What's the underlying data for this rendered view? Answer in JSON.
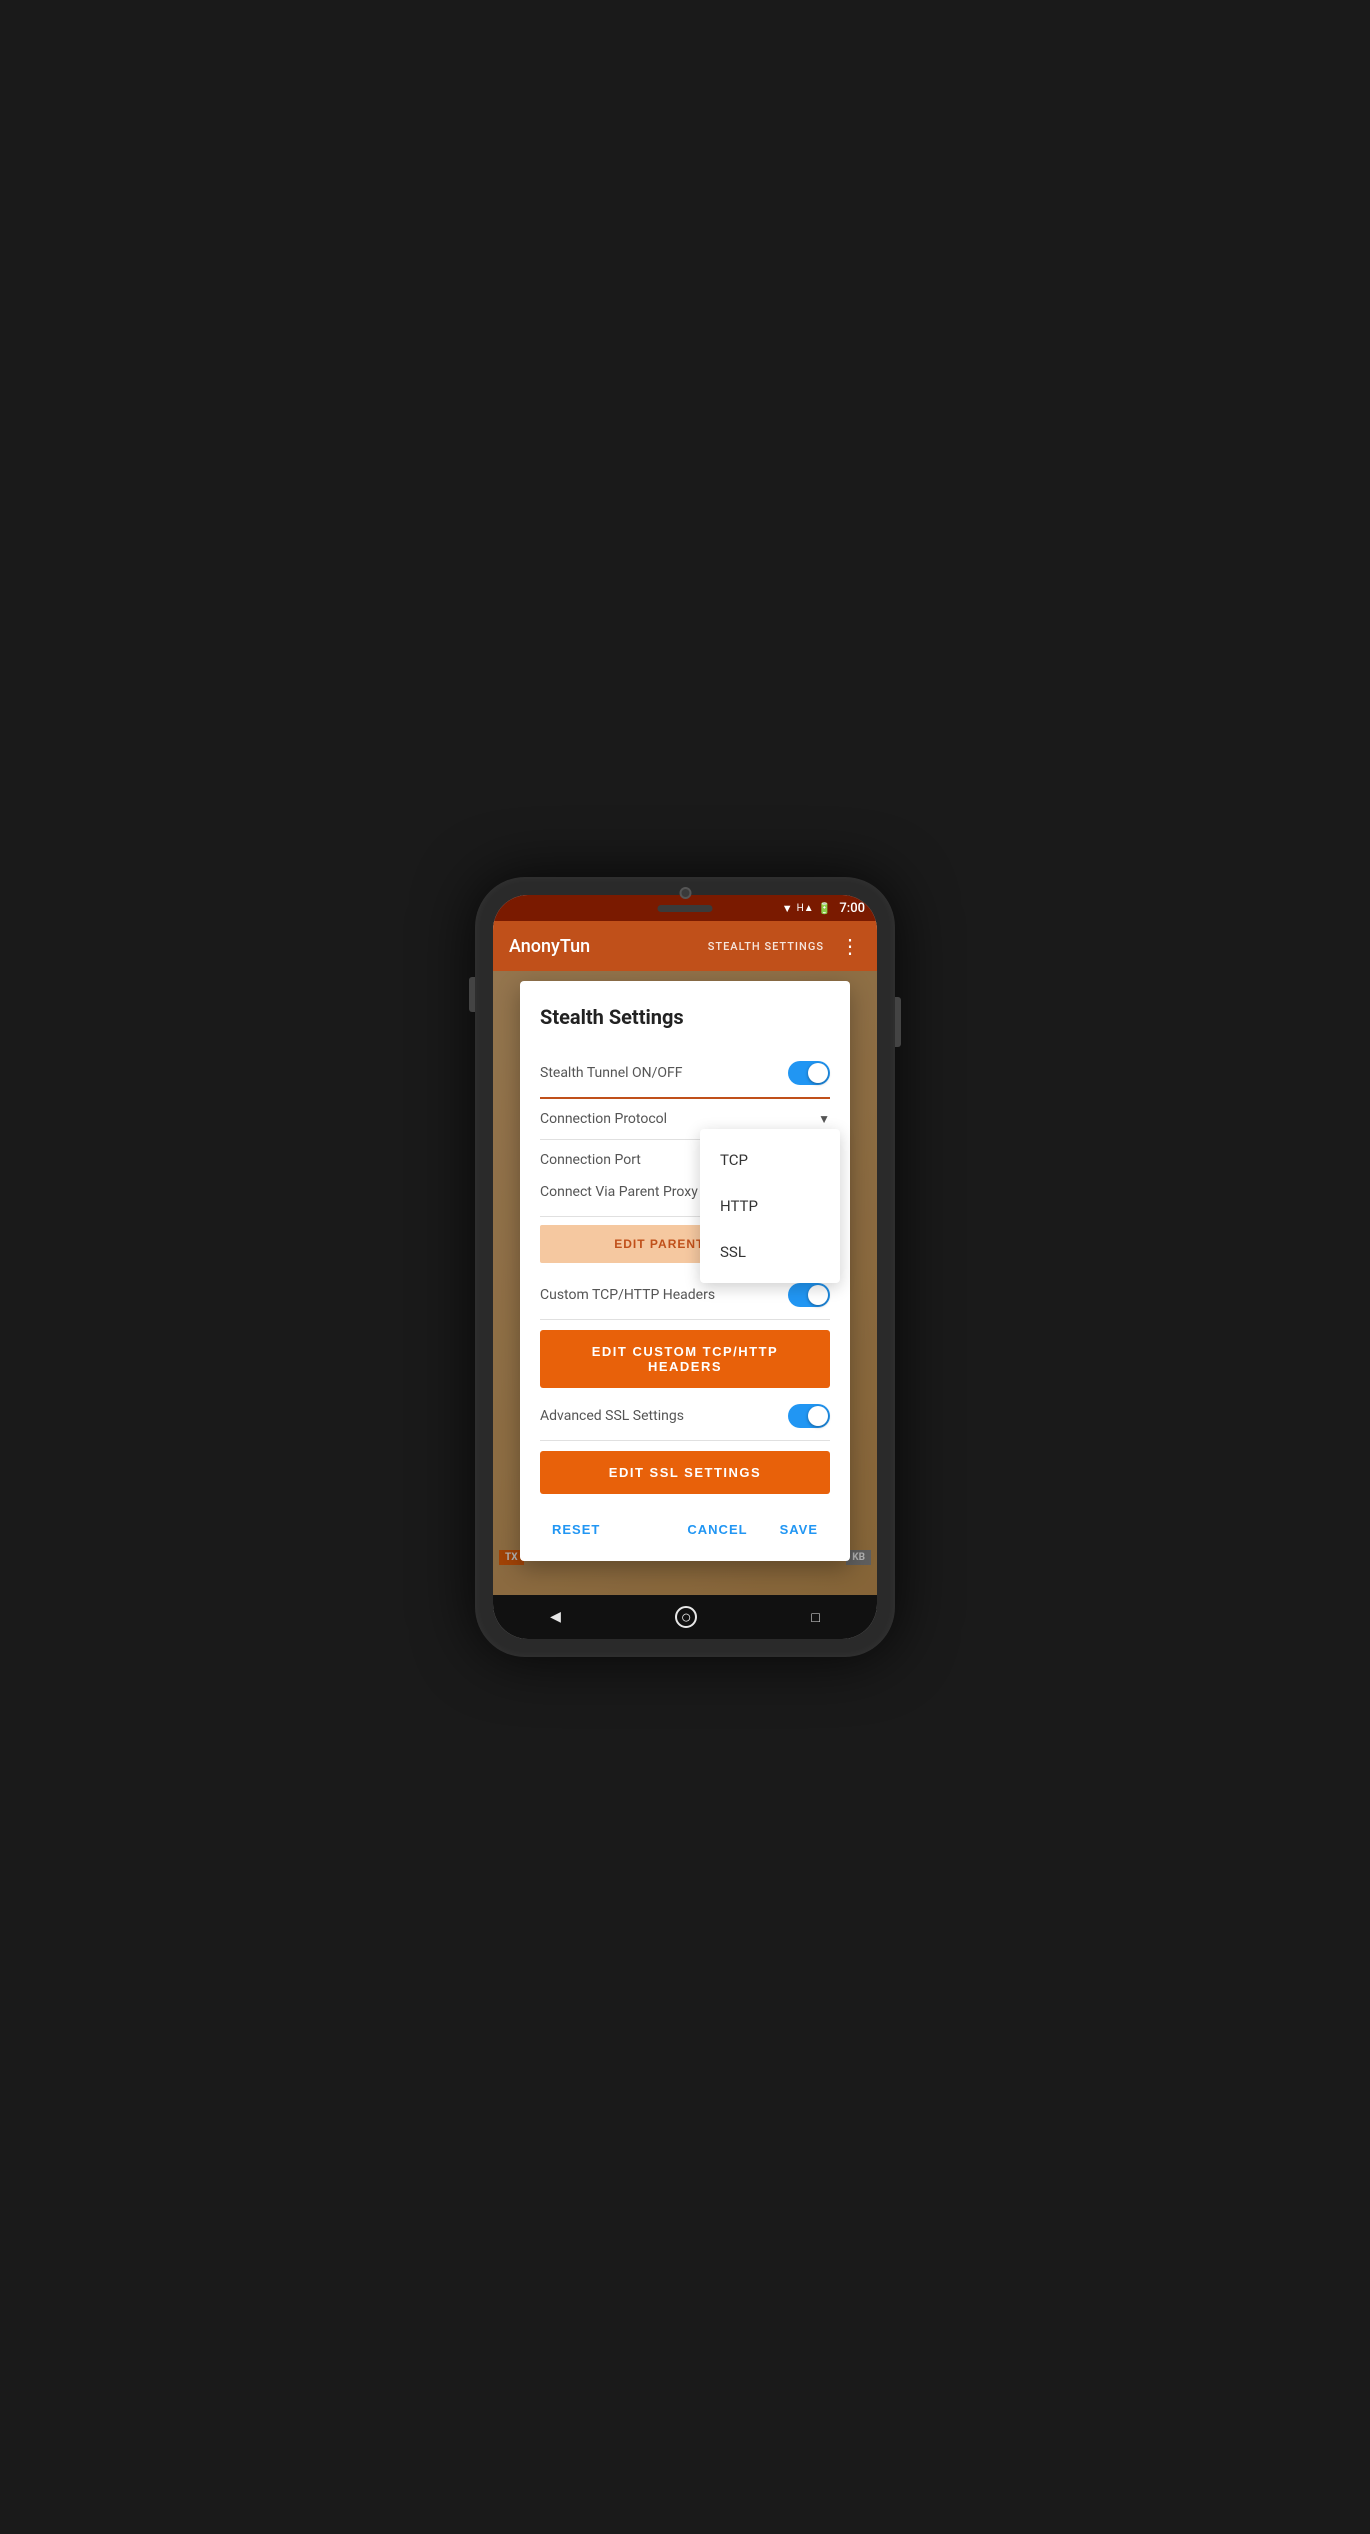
{
  "phone": {
    "status_bar": {
      "time": "7:00",
      "wifi_icon": "▼",
      "signal_icon": "H",
      "battery_icon": "▓"
    },
    "app_bar": {
      "title": "AnonyTun",
      "action_label": "STEALTH SETTINGS",
      "menu_icon": "⋮"
    }
  },
  "dialog": {
    "title": "Stealth Settings",
    "settings": [
      {
        "label": "Stealth Tunnel ON/OFF",
        "type": "toggle",
        "value": true
      },
      {
        "label": "Connection Protocol",
        "type": "dropdown",
        "value": "",
        "options": [
          "TCP",
          "HTTP",
          "SSL"
        ]
      },
      {
        "label": "Connection Port",
        "type": "text",
        "value": ""
      },
      {
        "label": "Connect Via Parent Proxy",
        "type": "toggle",
        "value": false
      }
    ],
    "edit_proxy_label": "EDIT PARENT PROXY",
    "custom_tcp_label": "Custom TCP/HTTP Headers",
    "custom_tcp_toggle": true,
    "edit_custom_btn": "EDIT CUSTOM TCP/HTTP HEADERS",
    "advanced_ssl_label": "Advanced SSL Settings",
    "advanced_ssl_toggle": true,
    "edit_ssl_btn": "EDIT SSL SETTINGS",
    "actions": {
      "reset": "RESET",
      "cancel": "CANCEL",
      "save": "SAVE"
    },
    "dropdown": {
      "options": [
        "TCP",
        "HTTP",
        "SSL"
      ],
      "arrow": "▼"
    }
  },
  "nav": {
    "back_icon": "◀",
    "home_icon": "○",
    "recent_icon": "□"
  },
  "background": {
    "tx_label": "TX",
    "kb_label": "KB"
  }
}
